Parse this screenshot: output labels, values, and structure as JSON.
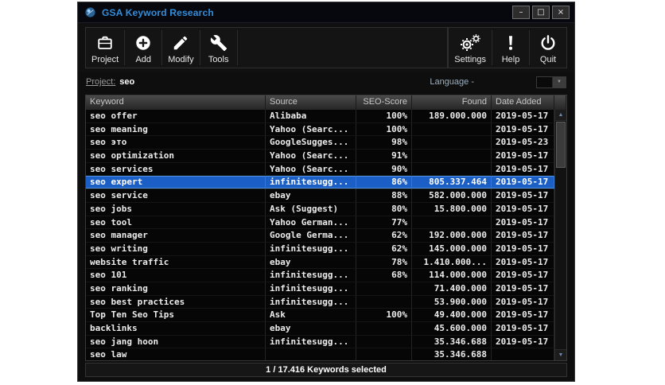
{
  "window": {
    "title": "GSA Keyword Research",
    "controls": {
      "minimize": "–",
      "maximize": "□",
      "close": "×"
    }
  },
  "toolbar": {
    "buttons_left": [
      {
        "label": "Project",
        "icon": "toolbox-icon"
      },
      {
        "label": "Add",
        "icon": "add-circle-icon"
      },
      {
        "label": "Modify",
        "icon": "pencil-icon"
      },
      {
        "label": "Tools",
        "icon": "wrench-icon"
      }
    ],
    "buttons_right": [
      {
        "label": "Settings",
        "icon": "gears-icon"
      },
      {
        "label": "Help",
        "icon": "exclamation-icon"
      },
      {
        "label": "Quit",
        "icon": "power-icon"
      }
    ]
  },
  "project_bar": {
    "project_label": "Project:",
    "project_value": "seo",
    "language_label": "Language -"
  },
  "table": {
    "columns": [
      "Keyword",
      "Source",
      "SEO-Score",
      "Found",
      "Date Added"
    ],
    "rows": [
      {
        "keyword": "seo offer",
        "source": "Alibaba",
        "score": "100%",
        "found": "189.000.000",
        "date": "2019-05-17",
        "selected": false
      },
      {
        "keyword": "seo meaning",
        "source": "Yahoo (Searc...",
        "score": "100%",
        "found": "",
        "date": "2019-05-17",
        "selected": false
      },
      {
        "keyword": "seo это",
        "source": "GoogleSugges...",
        "score": "98%",
        "found": "",
        "date": "2019-05-23",
        "selected": false
      },
      {
        "keyword": "seo optimization",
        "source": "Yahoo (Searc...",
        "score": "91%",
        "found": "",
        "date": "2019-05-17",
        "selected": false
      },
      {
        "keyword": "seo services",
        "source": "Yahoo (Searc...",
        "score": "90%",
        "found": "",
        "date": "2019-05-17",
        "selected": false
      },
      {
        "keyword": "seo expert",
        "source": "infinitesugg...",
        "score": "86%",
        "found": "805.337.464",
        "date": "2019-05-17",
        "selected": true
      },
      {
        "keyword": "seo service",
        "source": "ebay",
        "score": "88%",
        "found": "582.000.000",
        "date": "2019-05-17",
        "selected": false
      },
      {
        "keyword": "seo jobs",
        "source": "Ask (Suggest)",
        "score": "80%",
        "found": "15.800.000",
        "date": "2019-05-17",
        "selected": false
      },
      {
        "keyword": "seo tool",
        "source": "Yahoo German...",
        "score": "77%",
        "found": "",
        "date": "2019-05-17",
        "selected": false
      },
      {
        "keyword": "seo manager",
        "source": "Google Germa...",
        "score": "62%",
        "found": "192.000.000",
        "date": "2019-05-17",
        "selected": false
      },
      {
        "keyword": "seo writing",
        "source": "infinitesugg...",
        "score": "62%",
        "found": "145.000.000",
        "date": "2019-05-17",
        "selected": false
      },
      {
        "keyword": "website traffic",
        "source": "ebay",
        "score": "78%",
        "found": "1.410.000...",
        "date": "2019-05-17",
        "selected": false
      },
      {
        "keyword": "seo 101",
        "source": "infinitesugg...",
        "score": "68%",
        "found": "114.000.000",
        "date": "2019-05-17",
        "selected": false
      },
      {
        "keyword": "seo ranking",
        "source": "infinitesugg...",
        "score": "",
        "found": "71.400.000",
        "date": "2019-05-17",
        "selected": false
      },
      {
        "keyword": "seo best practices",
        "source": "infinitesugg...",
        "score": "",
        "found": "53.900.000",
        "date": "2019-05-17",
        "selected": false
      },
      {
        "keyword": "Top Ten Seo Tips",
        "source": "Ask",
        "score": "100%",
        "found": "49.400.000",
        "date": "2019-05-17",
        "selected": false
      },
      {
        "keyword": "backlinks",
        "source": "ebay",
        "score": "",
        "found": "45.600.000",
        "date": "2019-05-17",
        "selected": false
      },
      {
        "keyword": "seo jang hoon",
        "source": "infinitesugg...",
        "score": "",
        "found": "35.346.688",
        "date": "2019-05-17",
        "selected": false
      },
      {
        "keyword": "seo law",
        "source": "",
        "score": "",
        "found": "35.346.688",
        "date": "",
        "selected": false
      }
    ]
  },
  "status_bar": {
    "text": "1 / 17.416 Keywords selected"
  },
  "icons": {
    "scroll_up": "▲",
    "scroll_down": "▼",
    "combo_arrow": "▼"
  },
  "colors": {
    "accent_blue": "#1b5ec5",
    "title_blue": "#2f8fdd",
    "background": "#0e0e0e"
  }
}
